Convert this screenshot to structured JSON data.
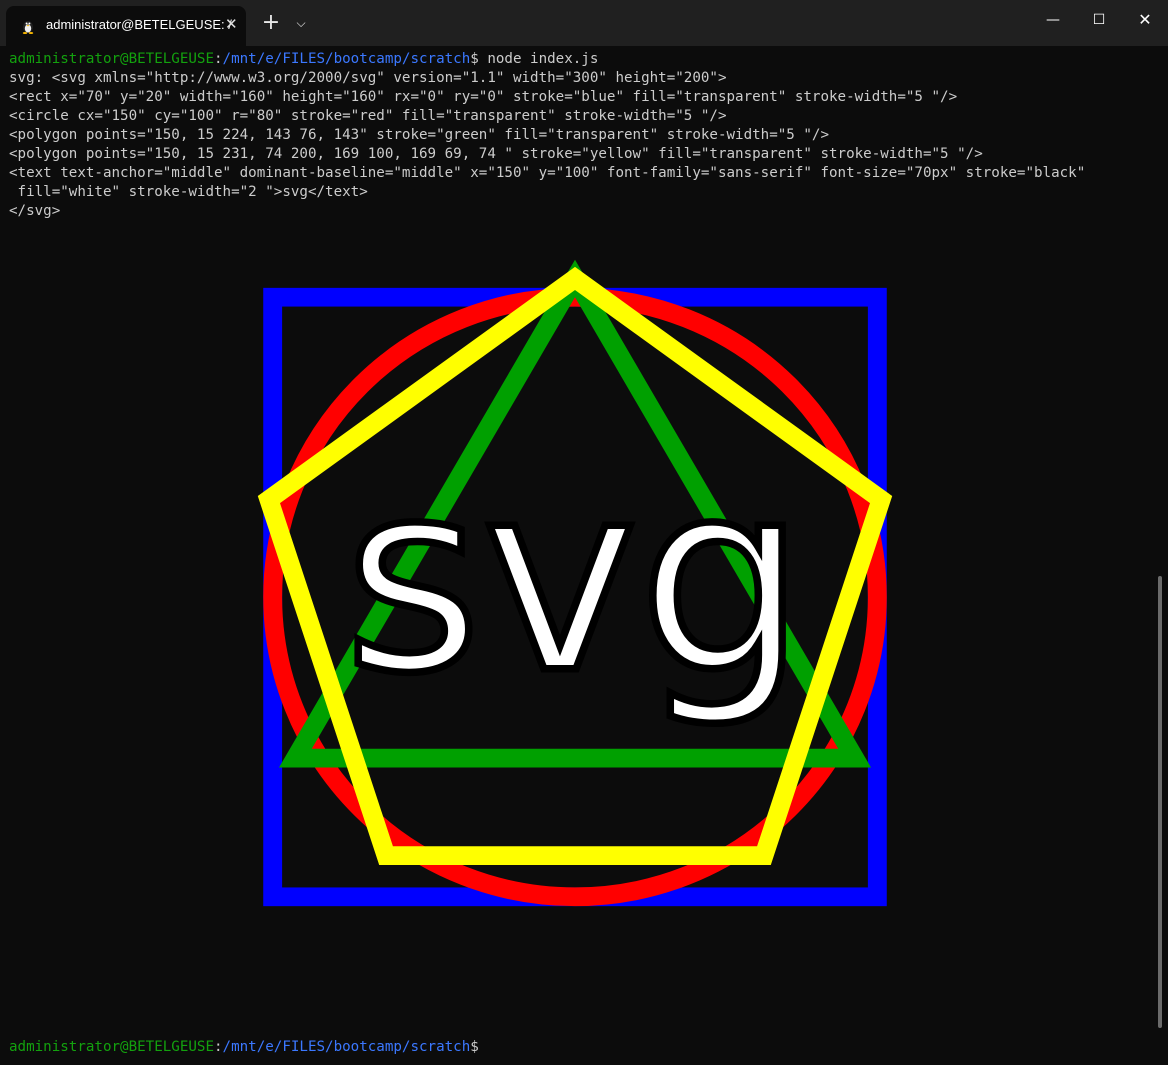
{
  "window": {
    "tab_title": "administrator@BETELGEUSE: /",
    "tab_close_icon": "close-icon",
    "new_tab_label": "+",
    "dropdown_label": "⌵",
    "min_label": "—",
    "max_label": "☐",
    "close_label": "✕"
  },
  "terminal": {
    "prompt_user": "administrator@BETELGEUSE",
    "prompt_sep": ":",
    "prompt_path": "/mnt/e/FILES/bootcamp/scratch",
    "prompt_dollar": "$",
    "command": " node index.js",
    "output": [
      "svg: <svg xmlns=\"http://www.w3.org/2000/svg\" version=\"1.1\" width=\"300\" height=\"200\">",
      "<rect x=\"70\" y=\"20\" width=\"160\" height=\"160\" rx=\"0\" ry=\"0\" stroke=\"blue\" fill=\"transparent\" stroke-width=\"5 \"/>",
      "<circle cx=\"150\" cy=\"100\" r=\"80\" stroke=\"red\" fill=\"transparent\" stroke-width=\"5 \"/>",
      "<polygon points=\"150, 15 224, 143 76, 143\" stroke=\"green\" fill=\"transparent\" stroke-width=\"5 \"/>",
      "<polygon points=\"150, 15 231, 74 200, 169 100, 169 69, 74 \" stroke=\"yellow\" fill=\"transparent\" stroke-width=\"5 \"/>",
      "<text text-anchor=\"middle\" dominant-baseline=\"middle\" x=\"150\" y=\"100\" font-family=\"sans-serif\" font-size=\"70px\" stroke=\"black\"",
      " fill=\"white\" stroke-width=\"2 \">svg</text>",
      "</svg>"
    ],
    "rendered_text": "svg"
  },
  "colors": {
    "background": "#0c0c0c",
    "user": "#13a10e",
    "path": "#3b78ff",
    "text": "#cccccc"
  }
}
